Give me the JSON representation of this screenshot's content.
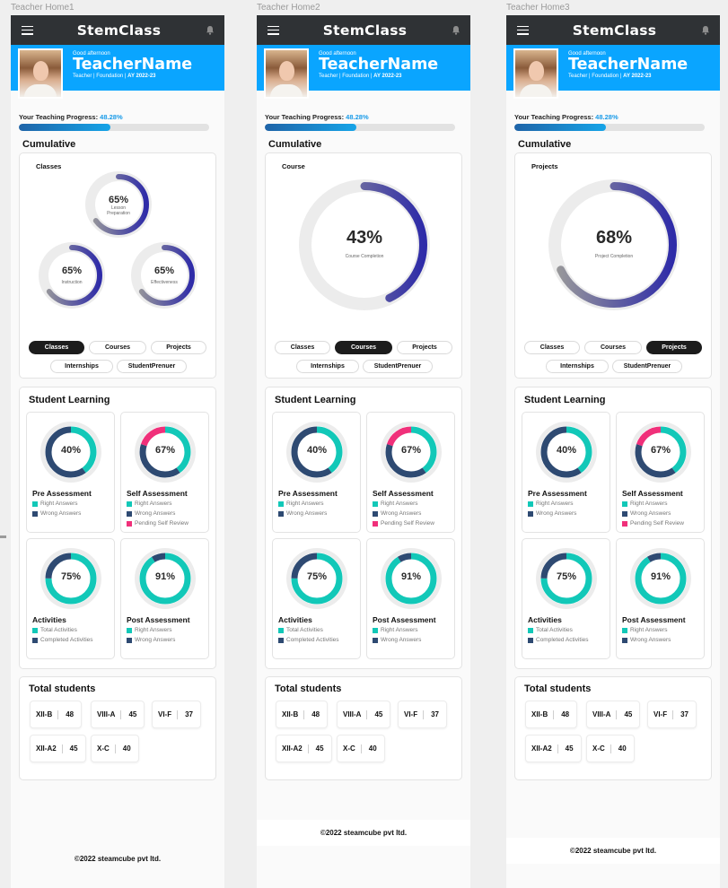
{
  "brand": "StemClass",
  "colors": {
    "topbar": "#2f3235",
    "hero": "#0aa5ff",
    "ring_track": "#e6e6e6",
    "ring_gradient_start": "#9a9a9a",
    "ring_gradient_end": "#2e2ba8",
    "right": "#12c8b8",
    "wrong": "#2e4a72",
    "pending": "#f0307a"
  },
  "icons": {
    "menu": "hamburger-menu-icon",
    "bell": "bell-icon"
  },
  "user": {
    "greeting": "Good afternoon",
    "name": "TeacherName",
    "role": "Teacher | Foundation | ",
    "year": "AY 2022-23"
  },
  "progress": {
    "label": "Your Teaching Progress:",
    "value": "48.28%",
    "fraction": 0.4828
  },
  "cumulative_title": "Cumulative",
  "tabs": [
    "Classes",
    "Courses",
    "Projects",
    "Internships",
    "StudentPrenuer"
  ],
  "student_learning": {
    "title": "Student Learning",
    "cards": [
      {
        "title": "Pre Assessment",
        "pct": "40%",
        "segments": [
          0.4,
          0.6
        ],
        "colors": [
          "#12c8b8",
          "#2e4a72"
        ],
        "legend": [
          "Right Answers",
          "Wrong Answers"
        ]
      },
      {
        "title": "Self Assessment",
        "pct": "67%",
        "segments": [
          0.4,
          0.4,
          0.2
        ],
        "colors": [
          "#12c8b8",
          "#2e4a72",
          "#f0307a"
        ],
        "legend": [
          "Right Answers",
          "Wrong Answers",
          "Pending Self Review"
        ]
      },
      {
        "title": "Activities",
        "pct": "75%",
        "segments": [
          0.75,
          0.25
        ],
        "colors": [
          "#12c8b8",
          "#2e4a72"
        ],
        "legend": [
          "Total Activities",
          "Completed Activities"
        ]
      },
      {
        "title": "Post Assessment",
        "pct": "91%",
        "segments": [
          0.91,
          0.09
        ],
        "colors": [
          "#12c8b8",
          "#2e4a72"
        ],
        "legend": [
          "Right Answers",
          "Wrong Answers"
        ]
      }
    ]
  },
  "total_students": {
    "title": "Total students",
    "classes": [
      {
        "name": "XII-B",
        "count": "48"
      },
      {
        "name": "VIII-A",
        "count": "45"
      },
      {
        "name": "VI-F",
        "count": "37"
      },
      {
        "name": "XII-A2",
        "count": "45"
      },
      {
        "name": "X-C",
        "count": "40"
      }
    ]
  },
  "footer": "©2022 steamcube pvt ltd.",
  "screens": [
    {
      "label": "Teacher Home1",
      "active_tab": "Classes",
      "cumulative_card": "Classes",
      "rings": [
        {
          "pct": "65%",
          "caption": "Lesson Preparation",
          "fraction": 0.65
        },
        {
          "pct": "65%",
          "caption": "Instruction",
          "fraction": 0.65
        },
        {
          "pct": "65%",
          "caption": "Effectiveness",
          "fraction": 0.65
        }
      ]
    },
    {
      "label": "Teacher Home2",
      "active_tab": "Courses",
      "cumulative_card": "Course",
      "rings": [
        {
          "pct": "43%",
          "caption": "Course Completion",
          "fraction": 0.43
        }
      ]
    },
    {
      "label": "Teacher Home3",
      "active_tab": "Projects",
      "cumulative_card": "Projects",
      "rings": [
        {
          "pct": "68%",
          "caption": "Project Completion",
          "fraction": 0.68
        }
      ]
    }
  ]
}
